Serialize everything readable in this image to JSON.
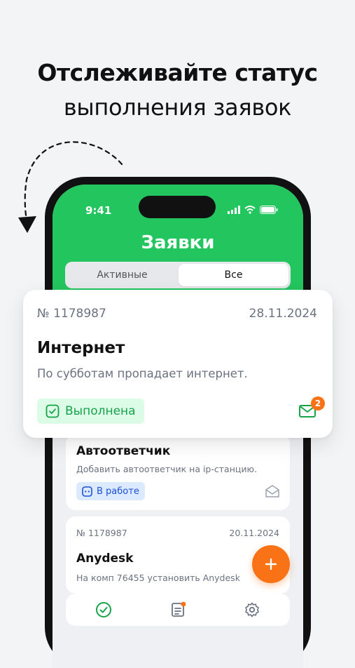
{
  "headline": {
    "line1": "Отслеживайте статус",
    "line2": "выполнения заявок"
  },
  "status_bar": {
    "time": "9:41"
  },
  "screen": {
    "title": "Заявки",
    "tabs": [
      {
        "label": "Активные"
      },
      {
        "label": "Все"
      }
    ],
    "selected_tab": "Все"
  },
  "featured_request": {
    "number": "№ 1178987",
    "date": "28.11.2024",
    "title": "Интернет",
    "description": "По субботам пропадает интернет.",
    "status": "Выполнена",
    "message_count": "2"
  },
  "requests": [
    {
      "title": "Автоответчик",
      "description": "Добавить автоответчик на ip-станцию.",
      "status": "В работе"
    },
    {
      "number": "№ 1178987",
      "date": "20.11.2024",
      "title": "Anydesk",
      "description": "На комп 76455 установить Anydesk"
    }
  ],
  "colors": {
    "brand_green": "#22c55e",
    "accent_orange": "#f97316",
    "done_green": "#16a34a",
    "in_work_blue": "#1d4ed8"
  },
  "icons": [
    "curved-arrow-icon",
    "signal-icon",
    "wifi-icon",
    "battery-icon",
    "check-square-icon",
    "mail-icon",
    "chat-square-icon",
    "envelope-open-icon",
    "plus-icon",
    "check-circle-icon",
    "notes-icon",
    "gear-icon"
  ]
}
